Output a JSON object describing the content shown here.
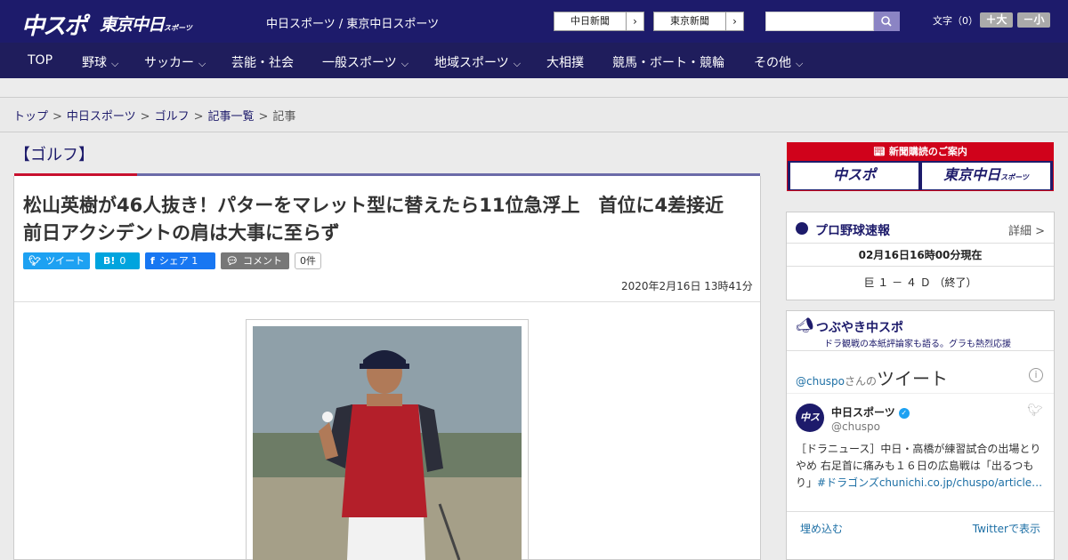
{
  "header": {
    "logo_primary": "中スポ",
    "logo_secondary": "東京中日",
    "logo_secondary_sub": "スポーツ",
    "site_links": "中日スポーツ / 東京中日スポーツ",
    "ext_links": [
      {
        "label": "中日新聞",
        "arrow": "›"
      },
      {
        "label": "東京新聞",
        "arrow": "›"
      }
    ],
    "search_placeholder": "",
    "font_size_label": "文字（0）",
    "font_increase": "＋大",
    "font_decrease": "－小"
  },
  "nav": [
    {
      "label": "TOP",
      "has_menu": false
    },
    {
      "label": "野球",
      "has_menu": true
    },
    {
      "label": "サッカー",
      "has_menu": true
    },
    {
      "label": "芸能・社会",
      "has_menu": false
    },
    {
      "label": "一般スポーツ",
      "has_menu": true
    },
    {
      "label": "地域スポーツ",
      "has_menu": true
    },
    {
      "label": "大相撲",
      "has_menu": false
    },
    {
      "label": "競馬・ボート・競輪",
      "has_menu": false
    },
    {
      "label": "その他",
      "has_menu": true
    }
  ],
  "breadcrumbs": [
    "トップ",
    "中日スポーツ",
    "ゴルフ",
    "記事一覧",
    "記事"
  ],
  "breadcrumb_sep": ">",
  "article": {
    "category": "【ゴルフ】",
    "headline": "松山英樹が46人抜き！パターをマレット型に替えたら11位急浮上　首位に4差接近　前日アクシデントの肩は大事に至らず",
    "share": {
      "tweet": "ツイート",
      "hatena_icon": "B!",
      "hatena_count": "0",
      "facebook": "シェア",
      "facebook_count": "1",
      "comment": "コメント",
      "comment_count": "0件"
    },
    "date": "2020年2月16日 13時41分"
  },
  "sidebar": {
    "subscribe_banner": "新聞購読のご案内",
    "subscribe_chuspo": "中スポ",
    "subscribe_tokyo": "東京中日",
    "subscribe_tokyo_sub": "スポーツ",
    "baseball": {
      "title": "プロ野球速報",
      "detail": "詳細 >",
      "time": "02月16日16時00分現在",
      "score": "巨 １ － ４ Ｄ （終了）"
    },
    "twitter": {
      "title": "つぶやき中スポ",
      "subtitle": "ドラ観戦の本紙評論家も語る。グラも熱烈応援",
      "handle": "@chuspo",
      "handle_suffix": "さんの",
      "heading": "ツイート",
      "name": "中日スポーツ",
      "at": "@chuspo",
      "avatar_text": "中スポ",
      "text_main": "［ドラニュース］中日・高橋が練習試合の出場とりやめ 右足首に痛みも１６日の広島戦は「出るつもり」",
      "text_link": "#ドラゴンズchunichi.co.jp/chuspo/article…",
      "embed": "埋め込む",
      "view": "Twitterで表示"
    }
  },
  "colors": {
    "header_bg": "#1d1b6b",
    "nav_bg": "#1f1d5c",
    "accent_red": "#c8102e",
    "link": "#1d6fa5",
    "twitter_blue": "#1da1f2",
    "facebook_blue": "#1877f2"
  },
  "icons": [
    "search-icon",
    "twitter-bird-icon",
    "facebook-icon",
    "comment-icon",
    "baseball-icon",
    "megaphone-icon",
    "info-icon",
    "verified-icon"
  ]
}
